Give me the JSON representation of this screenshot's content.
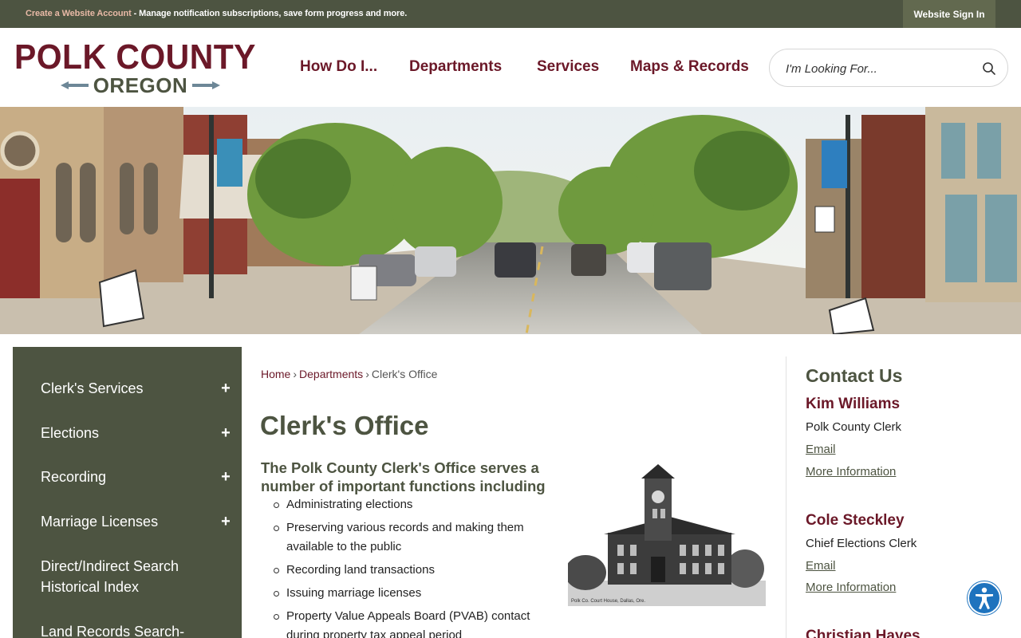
{
  "topbar": {
    "account_link": "Create a Website Account",
    "account_message": " - Manage notification subscriptions, save form progress and more.",
    "sign_in": "Website Sign In"
  },
  "logo": {
    "line1": "POLK COUNTY",
    "line2": "OREGON",
    "primary_color": "#6b1828",
    "secondary_color": "#4d5441",
    "accent_color": "#6d8797"
  },
  "nav": {
    "items": [
      "How Do I...",
      "Departments",
      "Services",
      "Maps & Records"
    ]
  },
  "search": {
    "placeholder": "I'm Looking For...",
    "icon": "search-icon"
  },
  "hero": {
    "icon": "downtown-street-photo"
  },
  "sidebar": {
    "items": [
      {
        "label": "Clerk's Services",
        "expand": "+"
      },
      {
        "label": "Elections",
        "expand": "+"
      },
      {
        "label": "Recording",
        "expand": "+"
      },
      {
        "label": "Marriage Licenses",
        "expand": "+"
      },
      {
        "label": "Direct/Indirect Search Historical Index",
        "expand": ""
      },
      {
        "label": "Land Records Search-",
        "expand": ""
      }
    ]
  },
  "breadcrumb": {
    "home": "Home",
    "sep1": "›",
    "departments": "Departments",
    "sep2": "›",
    "current": "Clerk's Office"
  },
  "main": {
    "title": "Clerk's Office",
    "intro": "The Polk County Clerk's Office serves a number of important functions including",
    "duties": [
      "Administrating elections",
      "Preserving various records and making them available to the public",
      "Recording land transactions",
      "Issuing marriage licenses",
      "Property Value Appeals Board (PVAB) contact during property tax appeal period"
    ],
    "photo_caption": "Polk Co. Court House, Dallas, Ore."
  },
  "contact": {
    "title": "Contact Us",
    "people": [
      {
        "name": "Kim Williams",
        "role": "Polk County Clerk",
        "email": "Email",
        "more": "More Information"
      },
      {
        "name": "Cole Steckley",
        "role": "Chief Elections Clerk",
        "email": "Email",
        "more": "More Information"
      },
      {
        "name": "Christian Hayes",
        "role": "",
        "email": "",
        "more": ""
      }
    ]
  },
  "accessibility": {
    "icon": "accessibility-icon",
    "color": "#1e73be"
  }
}
